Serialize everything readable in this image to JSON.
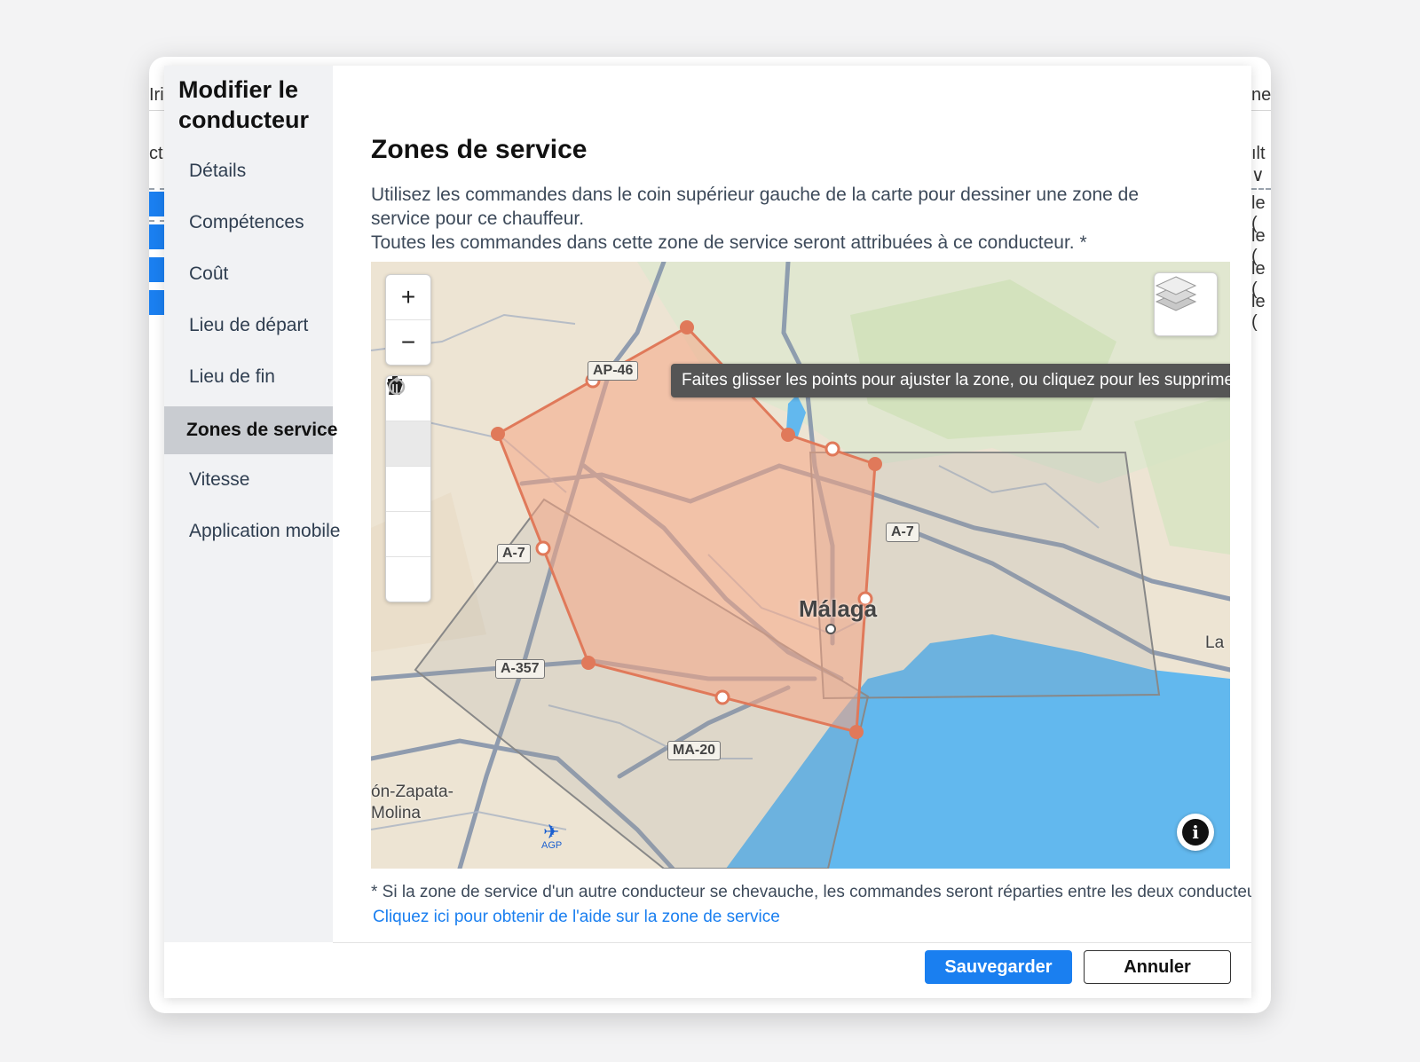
{
  "background": {
    "left_fragments": [
      "Iri",
      "ct"
    ],
    "right_fragments": [
      "ne",
      "ılt ∨",
      "le (",
      "le (",
      "le (",
      "le ("
    ]
  },
  "modal": {
    "title": "Modifier le conducteur",
    "nav": [
      {
        "label": "Détails",
        "active": false
      },
      {
        "label": "Compétences",
        "active": false
      },
      {
        "label": "Coût",
        "active": false
      },
      {
        "label": "Lieu de départ",
        "active": false
      },
      {
        "label": "Lieu de fin",
        "active": false
      },
      {
        "label": "Zones de service",
        "active": true
      },
      {
        "label": "Vitesse",
        "active": false
      },
      {
        "label": "Application mobile",
        "active": false
      }
    ],
    "section_title": "Zones de service",
    "description": {
      "line1": "Utilisez les commandes dans le coin supérieur gauche de la carte pour dessiner une zone de service pour ce chauffeur.",
      "line2": "Toutes les commandes dans cette zone de service seront attribuées à ce conducteur. *"
    },
    "map": {
      "tooltip": "Faites glisser les points pour ajuster la zone, ou cliquez pour les supprimer.",
      "controls": {
        "zoom_in": "+",
        "zoom_out": "−"
      },
      "road_labels": [
        "AP-46",
        "A-7",
        "A-7",
        "A-357",
        "MA-20"
      ],
      "city_label": "Málaga",
      "place_labels": [
        "ón-Zapata-\nMolina",
        "La",
        "AGP"
      ],
      "colors": {
        "zone_fill": "#f5a585",
        "zone_stroke": "#e0795a",
        "other_zone": "#8a8a8a",
        "sea": "#62b8ee"
      }
    },
    "footnote": "* Si la zone de service d'un autre conducteur se chevauche, les commandes seront réparties entre les deux conducteurs.",
    "help_link": "Cliquez ici pour obtenir de l'aide sur la zone de service",
    "buttons": {
      "save": "Sauvegarder",
      "cancel": "Annuler"
    }
  }
}
